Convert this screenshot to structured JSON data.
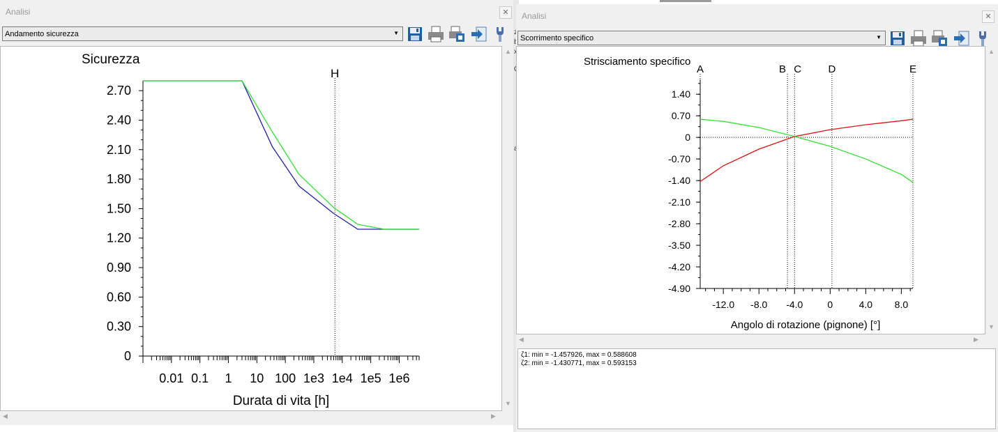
{
  "left_window": {
    "title": "Analisi",
    "close_icon": "close-icon",
    "dropdown_value": "Andamento sicurezza",
    "toolbar_icons": [
      "save-icon",
      "print-icon",
      "print-preview-icon",
      "export-icon",
      "settings-icon"
    ]
  },
  "right_window": {
    "title": "Analisi",
    "close_icon": "close-icon",
    "dropdown_value": "Scorrimento specifico",
    "toolbar_icons": [
      "save-icon",
      "print-icon",
      "print-preview-icon",
      "export-icon",
      "settings-icon"
    ],
    "log_lines": [
      "ζ1: min = -1.457926, max = 0.588608",
      "ζ2: min = -1.430771, max = 0.593153"
    ]
  },
  "background_letters": [
    "z",
    "b",
    "x",
    "Q",
    "a"
  ],
  "colors": {
    "blue": "#1f1fa8",
    "green": "#33e033",
    "red": "#dd1111",
    "axis": "#000000"
  },
  "chart_data": [
    {
      "type": "line",
      "title": "Sicurezza",
      "xlabel": "Durata di vita [h]",
      "ylabel": "",
      "x_scale": "log",
      "xlim": [
        0.001,
        5000000
      ],
      "ylim": [
        0,
        2.8
      ],
      "x_tick_values": [
        0.01,
        0.1,
        1,
        10,
        100,
        1000,
        10000,
        100000,
        1000000
      ],
      "x_tick_labels": [
        "0.01",
        "0.1",
        "1",
        "10",
        "100",
        "1e3",
        "1e4",
        "1e5",
        "1e6"
      ],
      "y_tick_values": [
        0,
        0.3,
        0.6,
        0.9,
        1.2,
        1.5,
        1.8,
        2.1,
        2.4,
        2.7
      ],
      "y_tick_labels": [
        "0",
        "0.30",
        "0.60",
        "0.90",
        "1.20",
        "1.50",
        "1.80",
        "2.10",
        "2.40",
        "2.70"
      ],
      "marker": {
        "label": "H",
        "x": 5500
      },
      "series": [
        {
          "color": "#1f1fa8",
          "x": [
            0.001,
            3,
            35,
            300,
            5000,
            35000,
            300000,
            5000000
          ],
          "y": [
            2.8,
            2.8,
            2.13,
            1.73,
            1.45,
            1.29,
            1.29,
            1.29
          ]
        },
        {
          "color": "#33e033",
          "x": [
            0.001,
            3,
            35,
            300,
            5000,
            35000,
            300000,
            5000000
          ],
          "y": [
            2.8,
            2.8,
            2.28,
            1.85,
            1.51,
            1.34,
            1.29,
            1.29
          ]
        }
      ]
    },
    {
      "type": "line",
      "title": "Strisciamento specifico",
      "xlabel": "Angolo di rotazione (pignone) [°]",
      "ylabel": "",
      "xlim": [
        -14.6,
        9.3
      ],
      "ylim": [
        -4.9,
        1.88
      ],
      "x_tick_values": [
        -12,
        -8,
        -4,
        0,
        4,
        8
      ],
      "x_tick_labels": [
        "-12.0",
        "-8.0",
        "-4.0",
        "0",
        "4.0",
        "8.0"
      ],
      "y_tick_values": [
        1.4,
        0.7,
        0,
        -0.7,
        -1.4,
        -2.1,
        -2.8,
        -3.5,
        -4.2,
        -4.9
      ],
      "y_tick_labels": [
        "1.40",
        "0.70",
        "0",
        "-0.70",
        "-1.40",
        "-2.10",
        "-2.80",
        "-3.50",
        "-4.20",
        "-4.90"
      ],
      "markers": [
        {
          "label": "A",
          "x": -14.6
        },
        {
          "label": "B",
          "x": -4.8
        },
        {
          "label": "C",
          "x": -4.0
        },
        {
          "label": "D",
          "x": 0.2
        },
        {
          "label": "E",
          "x": 9.3
        }
      ],
      "series": [
        {
          "color": "#dd1111",
          "x": [
            -14.6,
            -12,
            -8,
            -4,
            0,
            4,
            8,
            9.3
          ],
          "y": [
            -1.43,
            -0.92,
            -0.38,
            0.03,
            0.25,
            0.41,
            0.54,
            0.59
          ]
        },
        {
          "color": "#33e033",
          "x": [
            -14.6,
            -12,
            -8,
            -4,
            0,
            4,
            8,
            9.3
          ],
          "y": [
            0.59,
            0.52,
            0.32,
            0.03,
            -0.29,
            -0.7,
            -1.2,
            -1.46
          ]
        }
      ]
    }
  ]
}
